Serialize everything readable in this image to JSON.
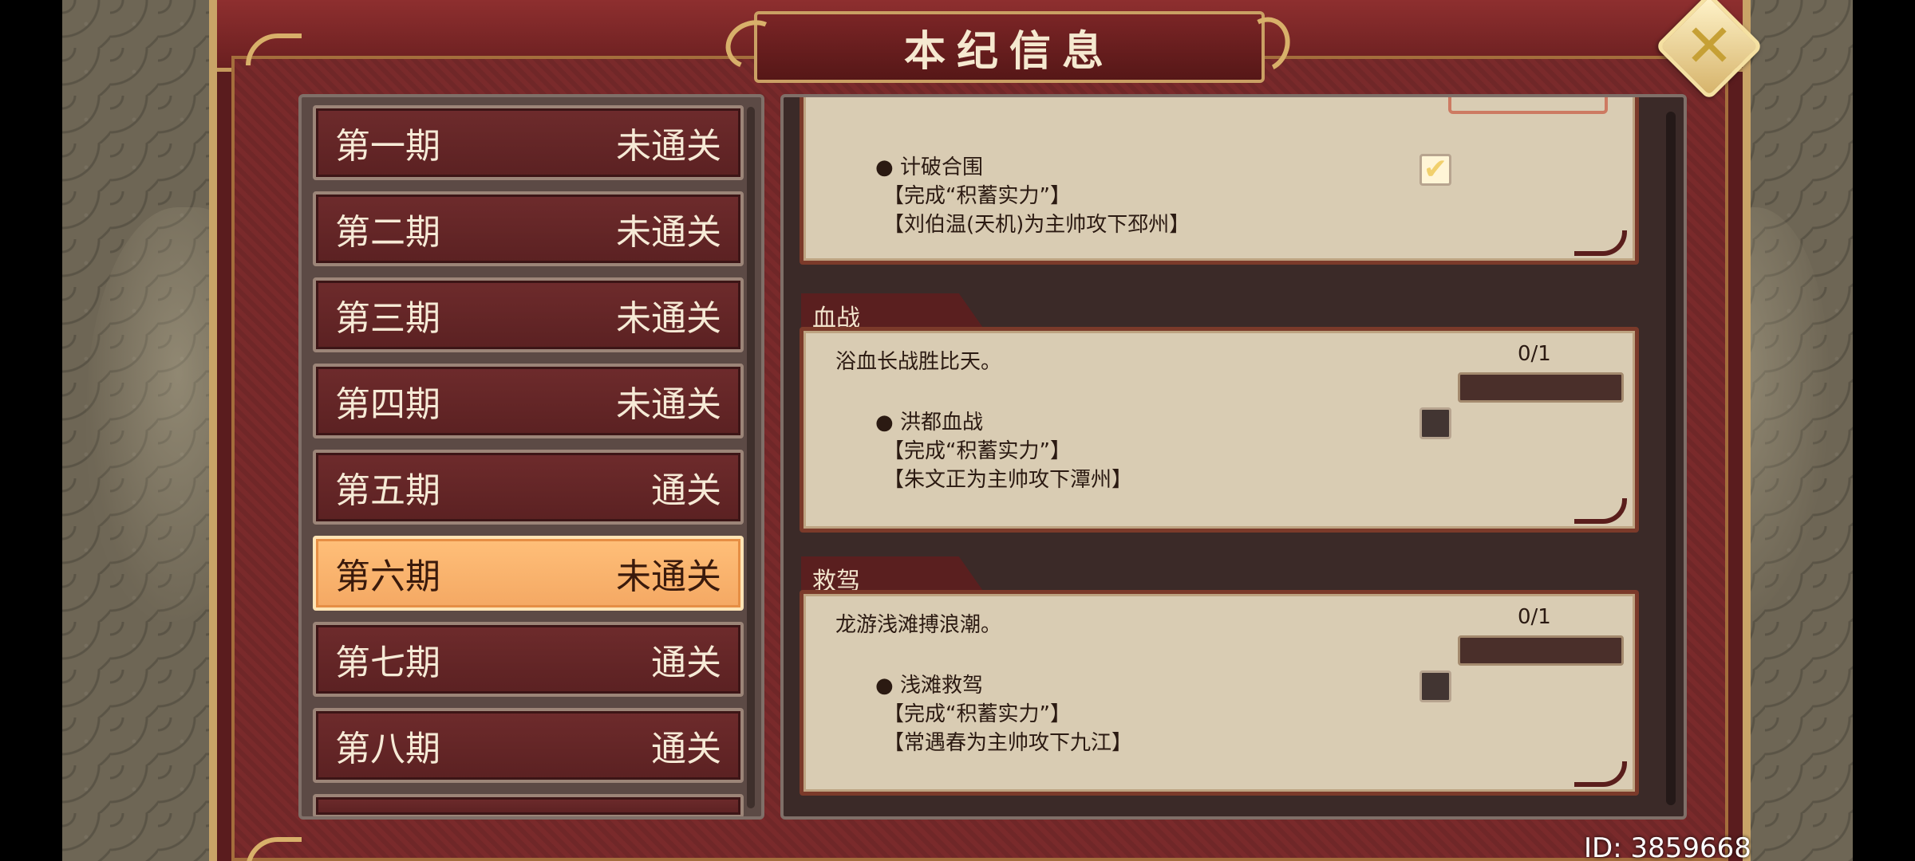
{
  "window": {
    "title": "本纪信息"
  },
  "close_icon": "close-icon",
  "periods": [
    {
      "name": "第一期",
      "status": "未通关",
      "active": false
    },
    {
      "name": "第二期",
      "status": "未通关",
      "active": false
    },
    {
      "name": "第三期",
      "status": "未通关",
      "active": false
    },
    {
      "name": "第四期",
      "status": "未通关",
      "active": false
    },
    {
      "name": "第五期",
      "status": "通关",
      "active": false
    },
    {
      "name": "第六期",
      "status": "未通关",
      "active": true
    },
    {
      "name": "第七期",
      "status": "通关",
      "active": false
    },
    {
      "name": "第八期",
      "status": "通关",
      "active": false
    }
  ],
  "tasks": [
    {
      "tab": "",
      "objective": "计破合围",
      "line1": "【完成“积蓄实力”】",
      "line2": "【刘伯温(天机)为主帅攻下邳州】",
      "checked": true
    },
    {
      "tab": "血战",
      "description": "浴血长战胜比天。",
      "progress": "0/1",
      "progress_value": 0,
      "objective": "洪都血战",
      "line1": "【完成“积蓄实力”】",
      "line2": "【朱文正为主帅攻下潭州】",
      "checked": false
    },
    {
      "tab": "救驾",
      "description": "龙游浅滩搏浪潮。",
      "progress": "0/1",
      "progress_value": 0,
      "objective": "浅滩救驾",
      "line1": "【完成“积蓄实力”】",
      "line2": "【常遇春为主帅攻下九江】",
      "checked": false
    }
  ],
  "checkmark": "✔",
  "bullet": "●",
  "id_label": "ID: 3859668"
}
